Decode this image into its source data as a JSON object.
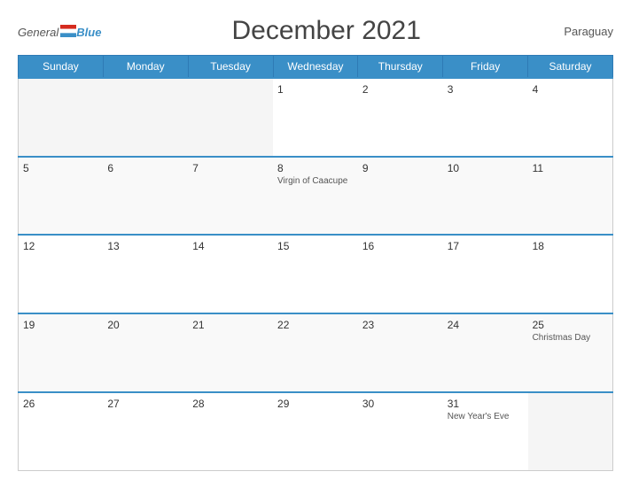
{
  "header": {
    "logo_general": "General",
    "logo_blue": "Blue",
    "title": "December 2021",
    "country": "Paraguay"
  },
  "days_of_week": [
    "Sunday",
    "Monday",
    "Tuesday",
    "Wednesday",
    "Thursday",
    "Friday",
    "Saturday"
  ],
  "weeks": [
    [
      {
        "day": "",
        "empty": true
      },
      {
        "day": "",
        "empty": true
      },
      {
        "day": "",
        "empty": true
      },
      {
        "day": "1",
        "holiday": ""
      },
      {
        "day": "2",
        "holiday": ""
      },
      {
        "day": "3",
        "holiday": ""
      },
      {
        "day": "4",
        "holiday": ""
      }
    ],
    [
      {
        "day": "5",
        "holiday": ""
      },
      {
        "day": "6",
        "holiday": ""
      },
      {
        "day": "7",
        "holiday": ""
      },
      {
        "day": "8",
        "holiday": "Virgin of Caacupe"
      },
      {
        "day": "9",
        "holiday": ""
      },
      {
        "day": "10",
        "holiday": ""
      },
      {
        "day": "11",
        "holiday": ""
      }
    ],
    [
      {
        "day": "12",
        "holiday": ""
      },
      {
        "day": "13",
        "holiday": ""
      },
      {
        "day": "14",
        "holiday": ""
      },
      {
        "day": "15",
        "holiday": ""
      },
      {
        "day": "16",
        "holiday": ""
      },
      {
        "day": "17",
        "holiday": ""
      },
      {
        "day": "18",
        "holiday": ""
      }
    ],
    [
      {
        "day": "19",
        "holiday": ""
      },
      {
        "day": "20",
        "holiday": ""
      },
      {
        "day": "21",
        "holiday": ""
      },
      {
        "day": "22",
        "holiday": ""
      },
      {
        "day": "23",
        "holiday": ""
      },
      {
        "day": "24",
        "holiday": ""
      },
      {
        "day": "25",
        "holiday": "Christmas Day"
      }
    ],
    [
      {
        "day": "26",
        "holiday": ""
      },
      {
        "day": "27",
        "holiday": ""
      },
      {
        "day": "28",
        "holiday": ""
      },
      {
        "day": "29",
        "holiday": ""
      },
      {
        "day": "30",
        "holiday": ""
      },
      {
        "day": "31",
        "holiday": "New Year's Eve"
      },
      {
        "day": "",
        "empty": true
      }
    ]
  ]
}
